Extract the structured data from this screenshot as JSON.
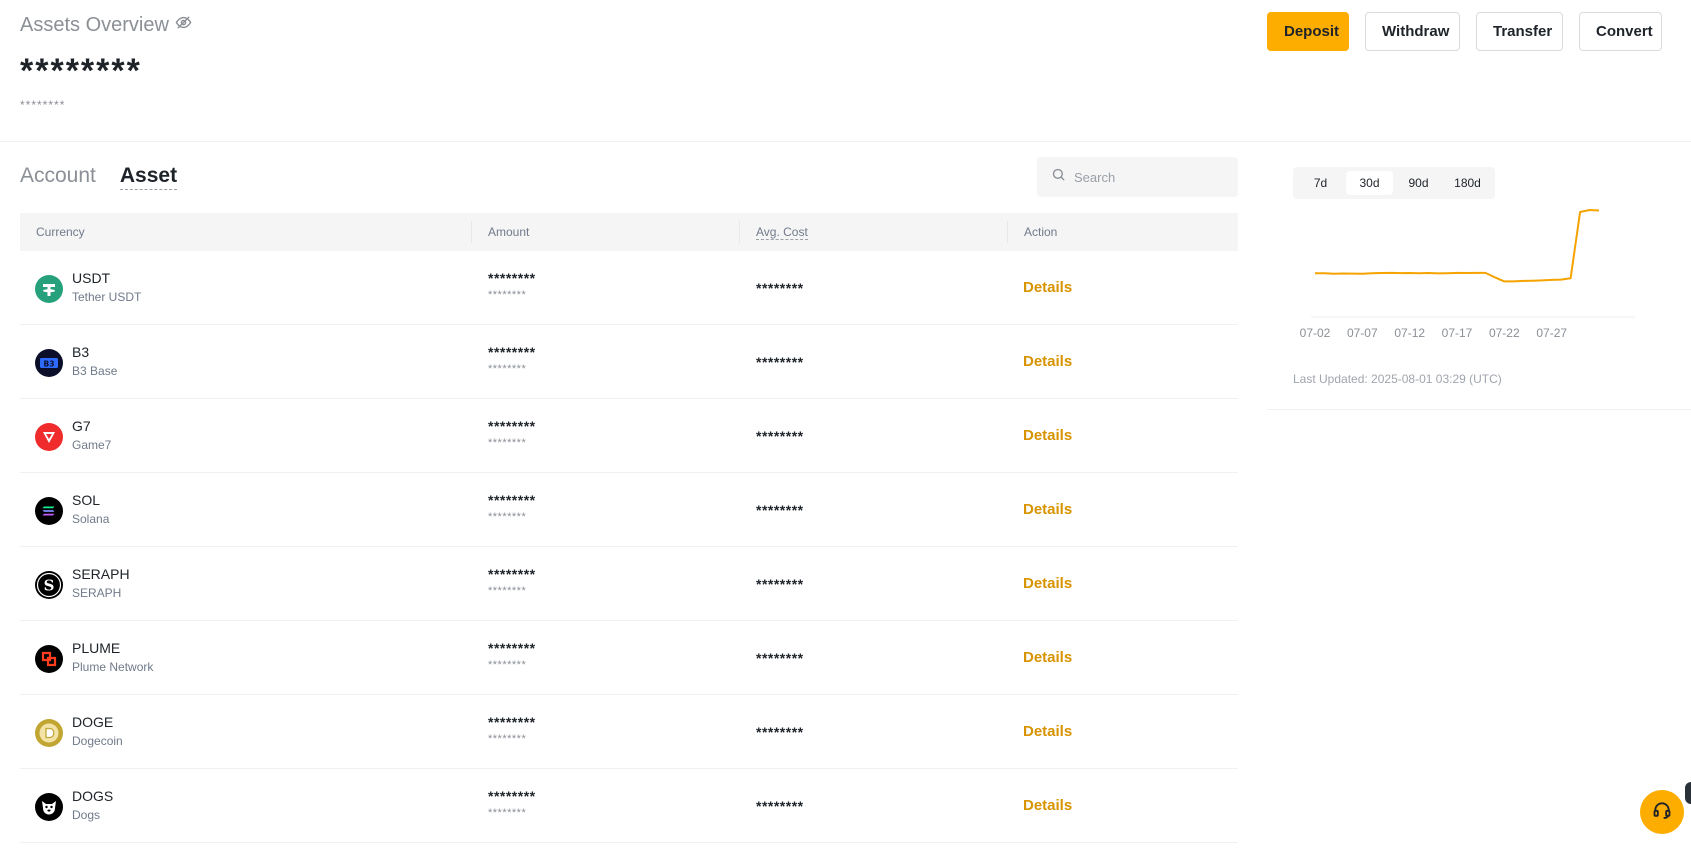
{
  "overview": {
    "title": "Assets Overview",
    "total": "********",
    "sub_total": "********"
  },
  "actions": {
    "deposit": "Deposit",
    "withdraw": "Withdraw",
    "transfer": "Transfer",
    "convert": "Convert"
  },
  "tabs": [
    {
      "label": "Account",
      "active": false
    },
    {
      "label": "Asset",
      "active": true
    }
  ],
  "search": {
    "placeholder": "Search",
    "value": ""
  },
  "table": {
    "headers": {
      "currency": "Currency",
      "amount": "Amount",
      "avg_cost": "Avg. Cost",
      "action": "Action"
    },
    "action_label": "Details",
    "rows": [
      {
        "symbol": "USDT",
        "name": "Tether USDT",
        "amount": "********",
        "amount_sub": "********",
        "avg_cost": "********",
        "icon": "usdt-icon",
        "color": "#26a17b"
      },
      {
        "symbol": "B3",
        "name": "B3 Base",
        "amount": "********",
        "amount_sub": "********",
        "avg_cost": "********",
        "icon": "b3-icon",
        "color": "#1d4ed8"
      },
      {
        "symbol": "G7",
        "name": "Game7",
        "amount": "********",
        "amount_sub": "********",
        "avg_cost": "********",
        "icon": "g7-icon",
        "color": "#ef2b2b"
      },
      {
        "symbol": "SOL",
        "name": "Solana",
        "amount": "********",
        "amount_sub": "********",
        "avg_cost": "********",
        "icon": "sol-icon",
        "color": "#000000"
      },
      {
        "symbol": "SERAPH",
        "name": "SERAPH",
        "amount": "********",
        "amount_sub": "********",
        "avg_cost": "********",
        "icon": "seraph-icon",
        "color": "#000000"
      },
      {
        "symbol": "PLUME",
        "name": "Plume Network",
        "amount": "********",
        "amount_sub": "********",
        "avg_cost": "********",
        "icon": "plume-icon",
        "color": "#000000"
      },
      {
        "symbol": "DOGE",
        "name": "Dogecoin",
        "amount": "********",
        "amount_sub": "********",
        "avg_cost": "********",
        "icon": "doge-icon",
        "color": "#c2a633"
      },
      {
        "symbol": "DOGS",
        "name": "Dogs",
        "amount": "********",
        "amount_sub": "********",
        "avg_cost": "********",
        "icon": "dogs-icon",
        "color": "#000000"
      }
    ]
  },
  "ranges": [
    {
      "label": "7d",
      "active": false
    },
    {
      "label": "30d",
      "active": true
    },
    {
      "label": "90d",
      "active": false
    },
    {
      "label": "180d",
      "active": false
    }
  ],
  "last_updated": "Last Updated: 2025-08-01 03:29 (UTC)",
  "accent_color": "#fcad00",
  "chart_data": {
    "type": "line",
    "title": "",
    "xlabel": "",
    "ylabel": "",
    "x_tick_labels": [
      "07-02",
      "07-07",
      "07-12",
      "07-17",
      "07-22",
      "07-27"
    ],
    "series": [
      {
        "color": "#f5a300",
        "x": [
          1,
          2,
          3,
          4,
          5,
          6,
          7,
          8,
          9,
          10,
          11,
          12,
          13,
          14,
          15,
          16,
          17,
          18,
          19,
          20,
          21,
          22,
          23,
          24,
          25,
          26,
          27,
          28,
          29,
          30,
          31
        ],
        "values": [
          0.38,
          0.38,
          0.375,
          0.377,
          0.376,
          0.375,
          0.38,
          0.382,
          0.383,
          0.381,
          0.382,
          0.38,
          0.382,
          0.378,
          0.38,
          0.383,
          0.382,
          0.383,
          0.383,
          0.34,
          0.3,
          0.3,
          0.305,
          0.307,
          0.31,
          0.315,
          0.318,
          0.33,
          0.98,
          1.0,
          0.995
        ]
      }
    ],
    "y_axis_labels": "none",
    "grid": false
  }
}
